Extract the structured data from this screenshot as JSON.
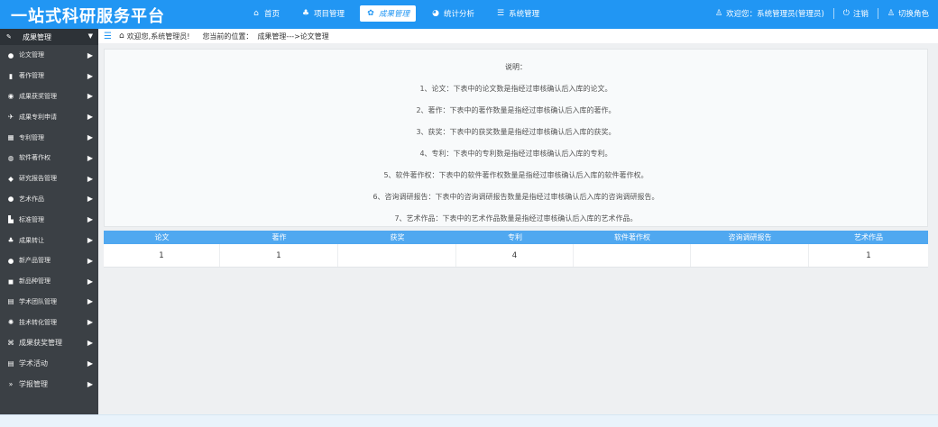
{
  "app_title": "一站式科研服务平台",
  "nav": [
    {
      "icon": "home-icon",
      "glyph": "⌂",
      "label": "首页",
      "active": false
    },
    {
      "icon": "sitemap-icon",
      "glyph": "♣",
      "label": "项目管理",
      "active": false
    },
    {
      "icon": "award-icon",
      "glyph": "✿",
      "label": "成果管理",
      "active": true
    },
    {
      "icon": "pie-chart-icon",
      "glyph": "◕",
      "label": "统计分析",
      "active": false
    },
    {
      "icon": "database-icon",
      "glyph": "☰",
      "label": "系统管理",
      "active": false
    }
  ],
  "user": {
    "welcome": "欢迎您：系统管理员(管理员)",
    "logout": "注销",
    "switch_role": "切换角色"
  },
  "sidebar": {
    "header": "成果管理",
    "items": [
      {
        "icon": "circle-icon",
        "glyph": "●",
        "label": "论文管理"
      },
      {
        "icon": "book-icon",
        "glyph": "▮",
        "label": "著作管理"
      },
      {
        "icon": "search-award-icon",
        "glyph": "◉",
        "label": "成果获奖管理"
      },
      {
        "icon": "rocket-icon",
        "glyph": "✈",
        "label": "成果专利申请"
      },
      {
        "icon": "patent-icon",
        "glyph": "▦",
        "label": "专利管理"
      },
      {
        "icon": "software-icon",
        "glyph": "◍",
        "label": "软件著作权"
      },
      {
        "icon": "shield-icon",
        "glyph": "◆",
        "label": "研究报告管理"
      },
      {
        "icon": "art-icon",
        "glyph": "●",
        "label": "艺术作品"
      },
      {
        "icon": "standard-icon",
        "glyph": "▙",
        "label": "标准管理"
      },
      {
        "icon": "transfer-icon",
        "glyph": "♣",
        "label": "成果转让"
      },
      {
        "icon": "product-icon",
        "glyph": "●",
        "label": "新产品管理"
      },
      {
        "icon": "variety-icon",
        "glyph": "◼",
        "label": "新品种管理"
      },
      {
        "icon": "team-icon",
        "glyph": "▤",
        "label": "学术团队管理"
      },
      {
        "icon": "tech-icon",
        "glyph": "✺",
        "label": "技术转化管理"
      },
      {
        "icon": "trophy-icon",
        "glyph": "⌘",
        "label": "成果获奖管理",
        "big": true
      },
      {
        "icon": "activity-icon",
        "glyph": "▤",
        "label": "学术活动",
        "big": true
      },
      {
        "icon": "double-chevron-icon",
        "glyph": "»",
        "label": "学报管理",
        "big": true
      }
    ]
  },
  "breadcrumb": {
    "welcome": "欢迎您,系统管理员!",
    "location": "您当前的位置：",
    "path": "成果管理--->论文管理"
  },
  "notes": {
    "title": "说明：",
    "lines": [
      "1、论文：下表中的论文数是指经过审核确认后入库的论文。",
      "2、著作：下表中的著作数量是指经过审核确认后入库的著作。",
      "3、获奖：下表中的获奖数量是指经过审核确认后入库的获奖。",
      "4、专利：下表中的专利数是指经过审核确认后入库的专利。",
      "5、软件著作权：下表中的软件著作权数量是指经过审核确认后入库的软件著作权。",
      "6、咨询调研报告：下表中的咨询调研报告数量是指经过审核确认后入库的咨询调研报告。",
      "7、艺术作品：下表中的艺术作品数量是指经过审核确认后入库的艺术作品。"
    ]
  },
  "table": {
    "headers": [
      "论文",
      "著作",
      "获奖",
      "专利",
      "软件著作权",
      "咨询调研报告",
      "艺术作品"
    ],
    "row": [
      "1",
      "1",
      "",
      "4",
      "",
      "",
      "1"
    ]
  },
  "colors": {
    "header_bg": "#2196f3",
    "sidebar_bg": "#3b4045",
    "table_head_bg": "#50a8f0"
  }
}
